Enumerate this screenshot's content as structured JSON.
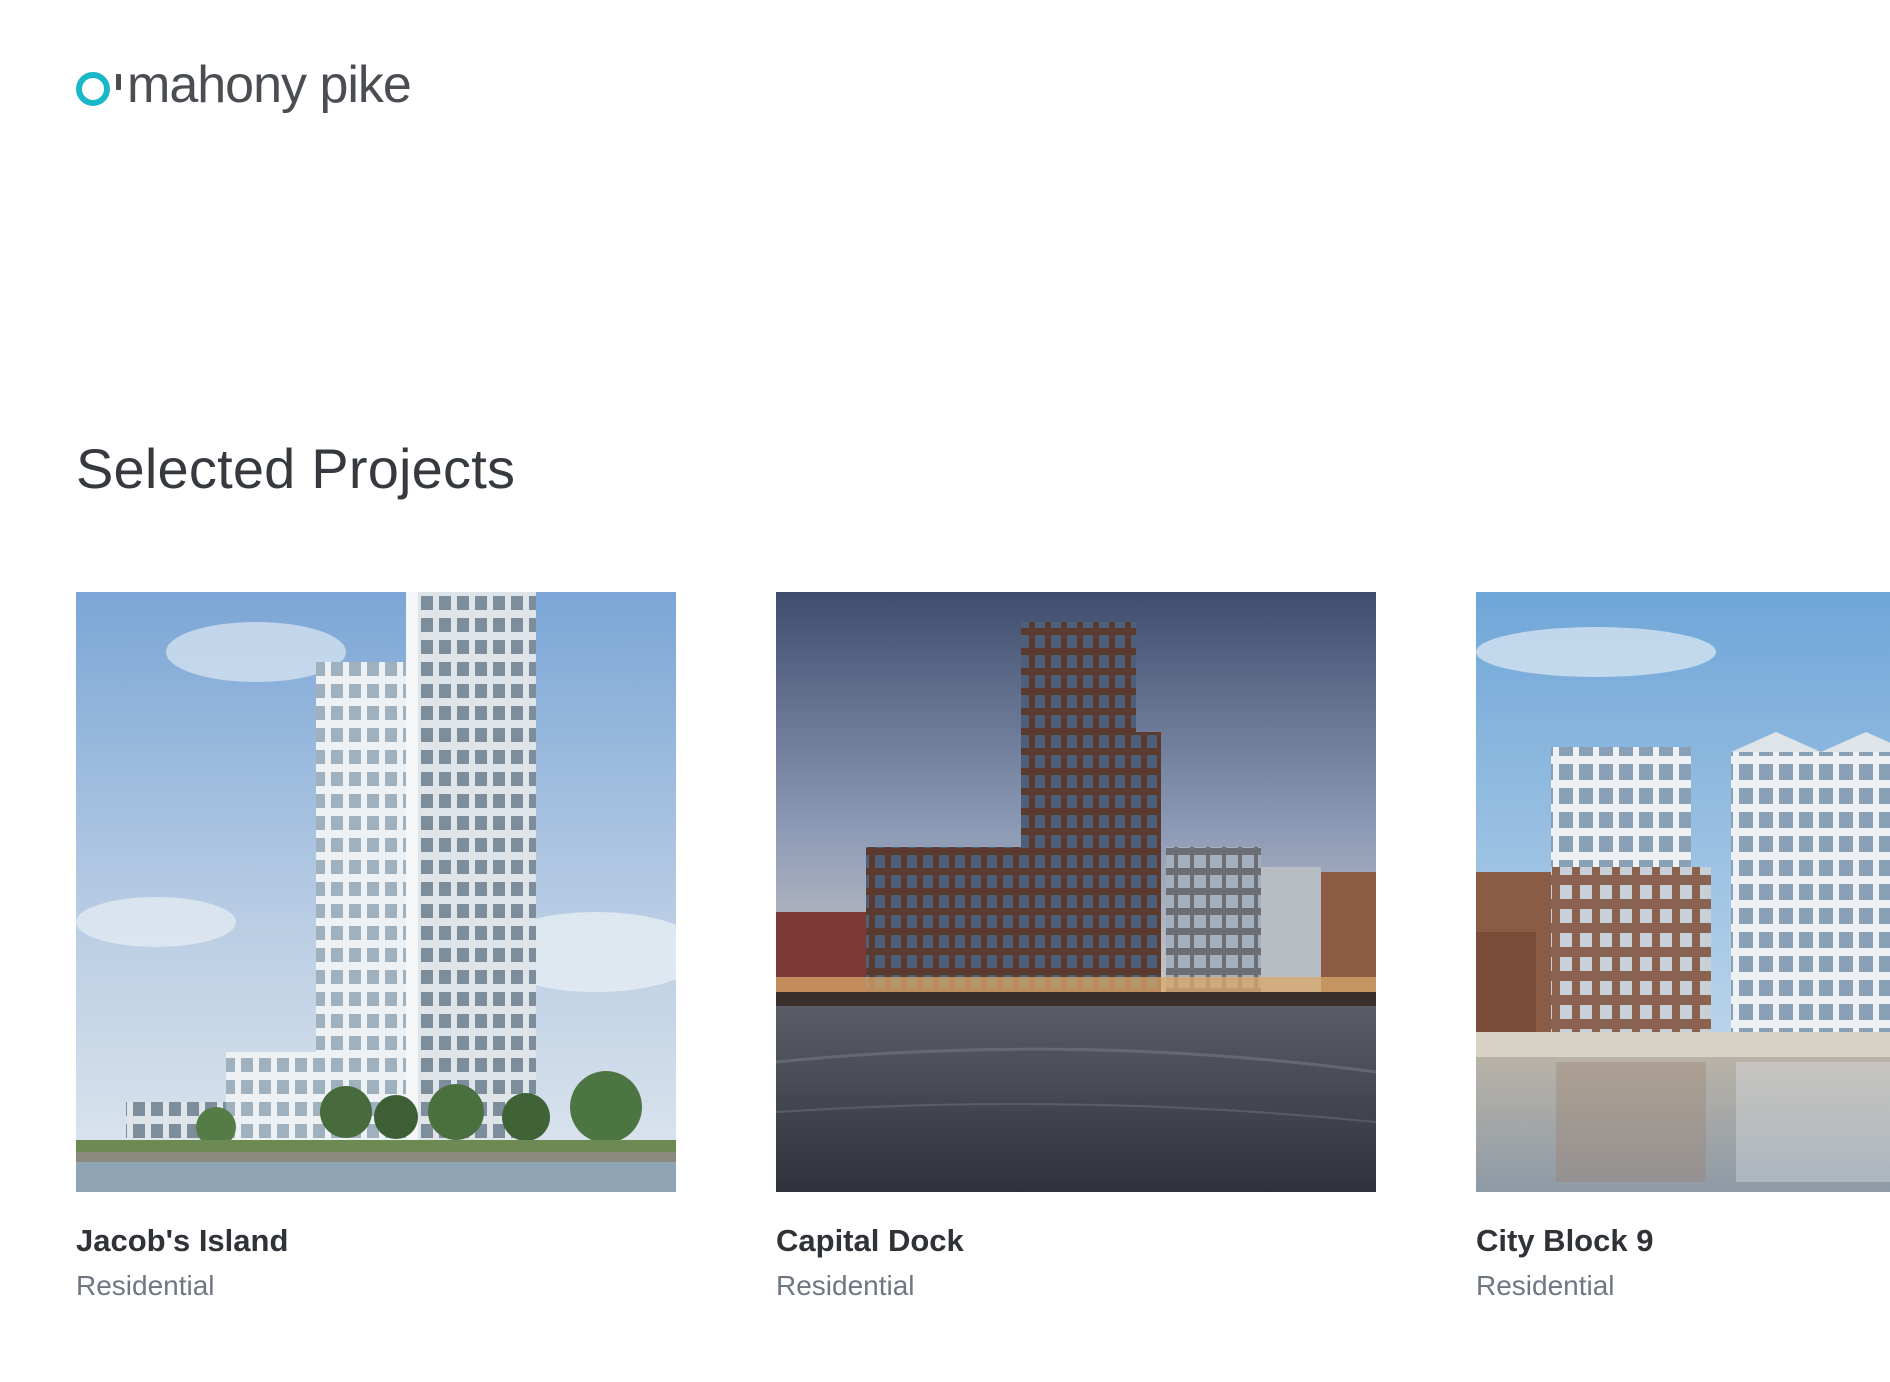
{
  "header": {
    "logo_text": "mahony pike",
    "logo_mark_color": "#19b8c9"
  },
  "section": {
    "title": "Selected Projects"
  },
  "projects": [
    {
      "title": "Jacob's Island",
      "category": "Residential"
    },
    {
      "title": "Capital Dock",
      "category": "Residential"
    },
    {
      "title": "City Block 9",
      "category": "Residential"
    }
  ]
}
